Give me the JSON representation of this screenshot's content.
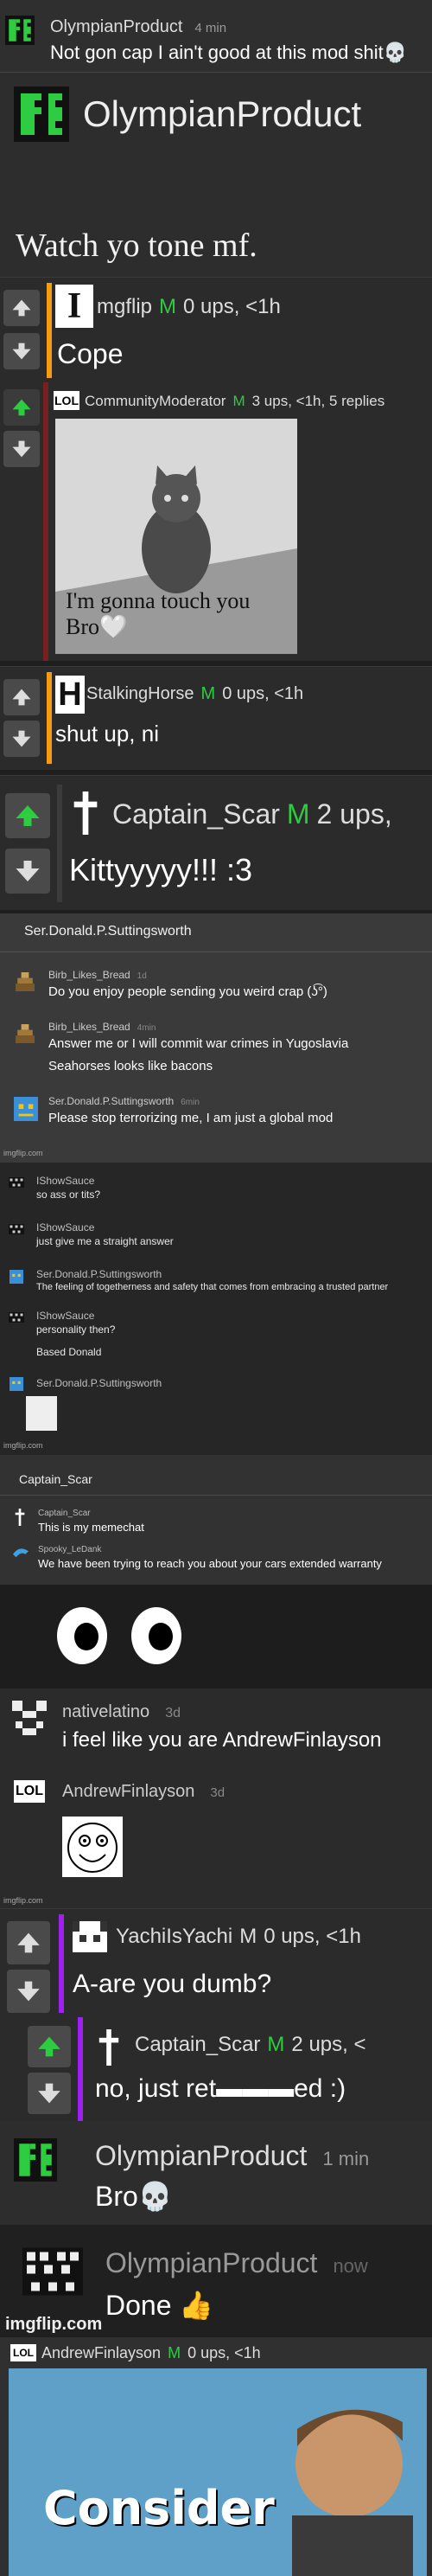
{
  "c1": {
    "user": "OlympianProduct",
    "time": "4 min",
    "text": "Not gon cap I ain't good at this mod shit💀"
  },
  "c2": {
    "user": "OlympianProduct",
    "text": "Watch yo tone mf."
  },
  "c3": {
    "user": "mgflip",
    "badge": "M",
    "meta": "0 ups, <1h",
    "text": "Cope"
  },
  "c4": {
    "user": "CommunityModerator",
    "badge": "M",
    "meta": "3 ups, <1h, 5 replies",
    "image_text": "I'm gonna touch you Bro🤍"
  },
  "c5": {
    "user": "StalkingHorse",
    "badge": "M",
    "meta": "0 ups, <1h",
    "text": "shut up, ni"
  },
  "c6": {
    "user": "Captain_Scar",
    "badge": "M",
    "meta": "2 ups,",
    "text": "Kittyyyyy!!! :3"
  },
  "chat": {
    "title": "Ser.Donald.P.Suttingsworth",
    "lines": [
      {
        "user": "Birb_Likes_Bread",
        "time": "1d",
        "text": "Do you enjoy people sending you weird crap (ʖ͡°)"
      },
      {
        "user": "Birb_Likes_Bread",
        "time": "4min",
        "text": "Answer me or I will commit war crimes in Yugoslavia"
      },
      {
        "user": "",
        "time": "",
        "text": "Seahorses looks like bacons"
      },
      {
        "user": "Ser.Donald.P.Suttingsworth",
        "time": "6min",
        "text": "Please stop terrorizing me, I am just a global mod"
      }
    ],
    "watermark": "imgflip.com"
  },
  "chat2": {
    "lines": [
      {
        "user": "IShowSauce",
        "text": "so ass or tits?"
      },
      {
        "user": "IShowSauce",
        "text": "just give me a straight answer"
      },
      {
        "user": "Ser.Donald.P.Suttingsworth",
        "text": "The feeling of togetherness and safety that comes from embracing a trusted partner"
      },
      {
        "user": "IShowSauce",
        "text": "personality then?"
      },
      {
        "user": "",
        "text": "Based Donald"
      },
      {
        "user": "Ser.Donald.P.Suttingsworth",
        "text": ""
      }
    ],
    "watermark": "imgflip.com"
  },
  "memechat": {
    "title": "Captain_Scar",
    "lines": [
      {
        "user": "Captain_Scar",
        "text": "This is my memechat"
      },
      {
        "user": "Spooky_LeDank",
        "text": "We have been trying to reach you about your cars extended warranty"
      }
    ]
  },
  "c7": {
    "user": "nativelatino",
    "time": "3d",
    "text": "i feel like you are AndrewFinlayson"
  },
  "c8": {
    "user": "AndrewFinlayson",
    "time": "3d",
    "watermark": "imgflip.com"
  },
  "c9": {
    "user": "YachiIsYachi",
    "badge": "M",
    "meta": "0 ups, <1h",
    "text": "A-are you dumb?"
  },
  "c10": {
    "user": "Captain_Scar",
    "badge": "M",
    "meta": "2 ups, <",
    "text": "no, just ret▬▬▬ed :)"
  },
  "c11": {
    "user": "OlympianProduct",
    "time": "1 min",
    "text": "Bro💀"
  },
  "c12": {
    "user": "OlympianProduct",
    "time": "now",
    "text": "Done 👍",
    "watermark": "imgflip.com"
  },
  "c13": {
    "user": "AndrewFinlayson",
    "badge": "M",
    "meta": "0 ups, <1h",
    "image_text": "Consider"
  },
  "colors": {
    "accent_green": "#2ecc40",
    "orange_stripe": "#f39c12",
    "purple_stripe": "#a020f0"
  }
}
